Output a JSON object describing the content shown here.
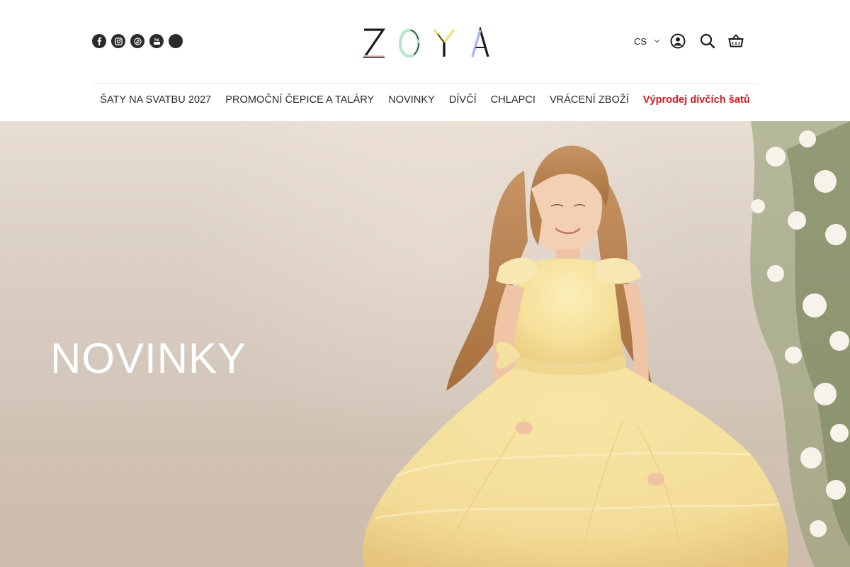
{
  "brand": {
    "name": "ZOYA",
    "letter_colors": [
      "#1a1a1a",
      "#b8e6c9",
      "#1a1a1a",
      "#1a1a1a"
    ],
    "letter_accents": [
      "#f4c8c8",
      "#b9e5c8",
      "#f2e27a",
      "#aeb9f2"
    ]
  },
  "social": [
    {
      "name": "facebook-icon"
    },
    {
      "name": "instagram-icon"
    },
    {
      "name": "pinterest-icon"
    },
    {
      "name": "youtube-icon"
    },
    {
      "name": "social-icon"
    }
  ],
  "header": {
    "language": "CS"
  },
  "nav": {
    "items": [
      "ŠATY NA SVATBU 2027",
      "PROMOČNÍ ČEPICE A TALÁRY",
      "NOVINKY",
      "DÍVČÍ",
      "CHLAPCI",
      "VRÁCENÍ ZBOŽÍ"
    ],
    "sale": "Výprodej dívčích šatů",
    "sale_color": "#d8191f"
  },
  "hero": {
    "title": "NOVINKY"
  }
}
